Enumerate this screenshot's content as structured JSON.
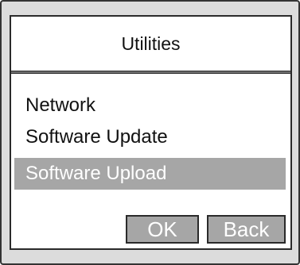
{
  "screen": {
    "title": "Utilities"
  },
  "menu": {
    "items": [
      {
        "label": "Network",
        "selected": false
      },
      {
        "label": "Software Update",
        "selected": false
      },
      {
        "label": "Software Upload",
        "selected": true
      }
    ]
  },
  "buttons": {
    "ok_label": "OK",
    "back_label": "Back"
  },
  "colors": {
    "selection": "#a6a6a6",
    "button_fill": "#a6a6a6",
    "device_frame": "#dcdcdc"
  }
}
